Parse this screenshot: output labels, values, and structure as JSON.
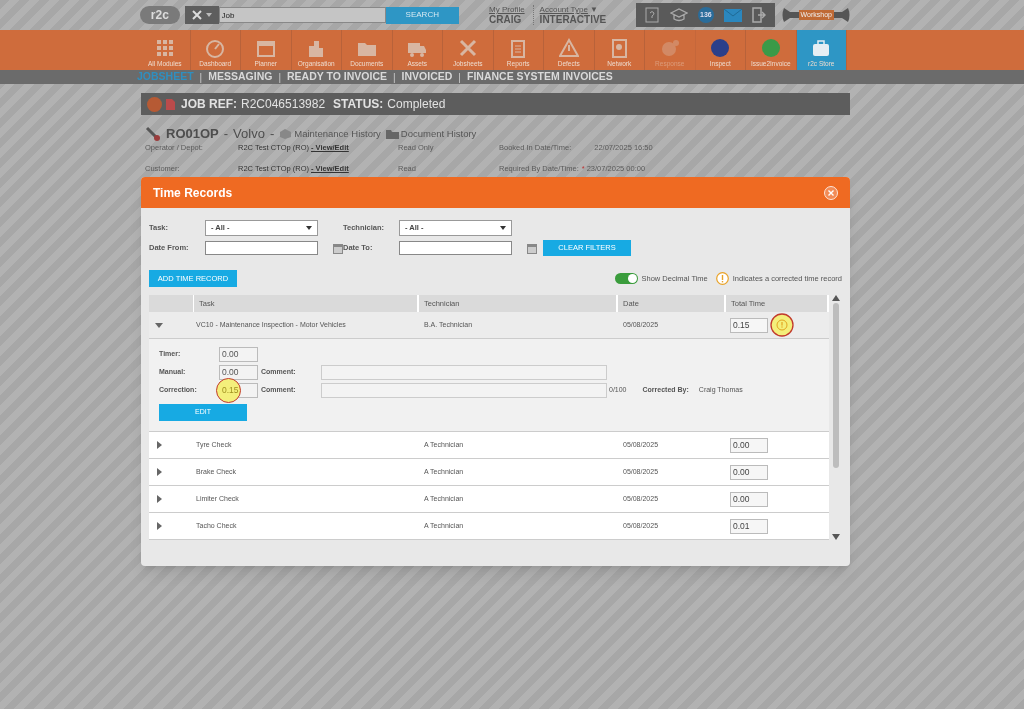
{
  "top_bar": {
    "logo": "r2c",
    "search": {
      "value": "Job"
    },
    "search_button": "SEARCH",
    "profile_link": "My Profile",
    "user": "CRAIG",
    "account_type_link": "Account Type",
    "account_type_caret": "▼",
    "account_type": "INTERACTIVE",
    "notification_count": "136",
    "workshop_label": "Workshop"
  },
  "modules": [
    {
      "label": "All Modules",
      "selected": false,
      "disabled": false
    },
    {
      "label": "Dashboard",
      "selected": false,
      "disabled": false
    },
    {
      "label": "Planner",
      "selected": false,
      "disabled": false
    },
    {
      "label": "Organisation",
      "selected": false,
      "disabled": false
    },
    {
      "label": "Documents",
      "selected": false,
      "disabled": false
    },
    {
      "label": "Assets",
      "selected": false,
      "disabled": false
    },
    {
      "label": "Jobsheets",
      "selected": false,
      "disabled": false
    },
    {
      "label": "Reports",
      "selected": false,
      "disabled": false
    },
    {
      "label": "Defects",
      "selected": false,
      "disabled": false
    },
    {
      "label": "Network",
      "selected": false,
      "disabled": false
    },
    {
      "label": "Response",
      "selected": false,
      "disabled": true
    },
    {
      "label": "Inspect",
      "selected": false,
      "disabled": false
    },
    {
      "label": "Issue2Invoice",
      "selected": false,
      "disabled": false
    },
    {
      "label": "r2c Store",
      "selected": true,
      "disabled": false
    }
  ],
  "sub_nav": [
    {
      "label": "JOBSHEET",
      "selected": true
    },
    {
      "separator": "|",
      "label": "MESSAGING",
      "selected": false
    },
    {
      "separator": "|",
      "label": "READY TO INVOICE",
      "selected": false
    },
    {
      "separator": "|",
      "label": "INVOICED",
      "selected": false
    },
    {
      "separator": "|",
      "label": "FINANCE SYSTEM INVOICES",
      "selected": false
    }
  ],
  "job": {
    "ref_label": "JOB REF:",
    "ref": "R2C046513982",
    "status_label": "STATUS:",
    "status": "Completed",
    "vehicle": {
      "registration": "RO01OP",
      "separator_1": "-",
      "make": "Volvo",
      "separator_2": "-"
    },
    "links": [
      "Maintenance History",
      "Document History"
    ],
    "details": [
      {
        "label": "Operator / Depot:",
        "value": "R2C Test CTOp (RO)",
        "link": "- View/Edit",
        "access": "Read Only",
        "date_label": "Booked In Date/Time:",
        "required": false,
        "date": "22/07/2025 16:50"
      },
      {
        "label": "Customer:",
        "value": "R2C Test CTOp (RO)",
        "link": "- View/Edit",
        "access": "Read",
        "date_label": "Required By Date/Time:",
        "required": true,
        "required_mark": "*",
        "date": "23/07/2025 00:00"
      }
    ]
  },
  "dialog": {
    "title": "Time Records",
    "filters": [
      {
        "kind": "select",
        "label": "Task:",
        "value": "- All -"
      },
      {
        "kind": "select",
        "label": "Technician:",
        "value": "- All -"
      },
      {
        "kind": "date",
        "label": "Date From:"
      },
      {
        "kind": "date",
        "label": "Date To:"
      }
    ],
    "clear_button": "CLEAR FILTERS",
    "add_button": "ADD TIME RECORD",
    "toggle": {
      "label": "Show Decimal Time",
      "on": true
    },
    "legend": "Indicates a corrected time record",
    "columns": [
      "Task",
      "Technician",
      "Date",
      "Total Time"
    ],
    "rows": [
      {
        "task": "VC10 - Maintenance Inspection - Motor Vehicles",
        "technician": "B.A. Technician",
        "date": "05/08/2025",
        "total": "0.15",
        "expanded": true,
        "corrected": true,
        "details": {
          "fields": [
            {
              "label": "Timer:",
              "value": "0.00",
              "highlighted": false
            },
            {
              "label": "Manual:",
              "value": "0.00",
              "highlighted": false,
              "comment_label": "Comment:"
            },
            {
              "label": "Correction:",
              "value": "0.15",
              "highlighted": true,
              "comment_label": "Comment:",
              "char_count": "0/100",
              "corrected_by_label": "Corrected By:",
              "corrected_by": "Craig Thomas"
            }
          ],
          "edit_button": "EDIT"
        }
      },
      {
        "task": "Tyre Check",
        "technician": "A Technician",
        "date": "05/08/2025",
        "total": "0.00",
        "expanded": false,
        "corrected": false
      },
      {
        "task": "Brake Check",
        "technician": "A Technician",
        "date": "05/08/2025",
        "total": "0.00",
        "expanded": false,
        "corrected": false
      },
      {
        "task": "Limiter Check",
        "technician": "A Technician",
        "date": "05/08/2025",
        "total": "0.00",
        "expanded": false,
        "corrected": false
      },
      {
        "task": "Tacho Check",
        "technician": "A Technician",
        "date": "05/08/2025",
        "total": "0.01",
        "expanded": false,
        "corrected": false
      }
    ]
  }
}
